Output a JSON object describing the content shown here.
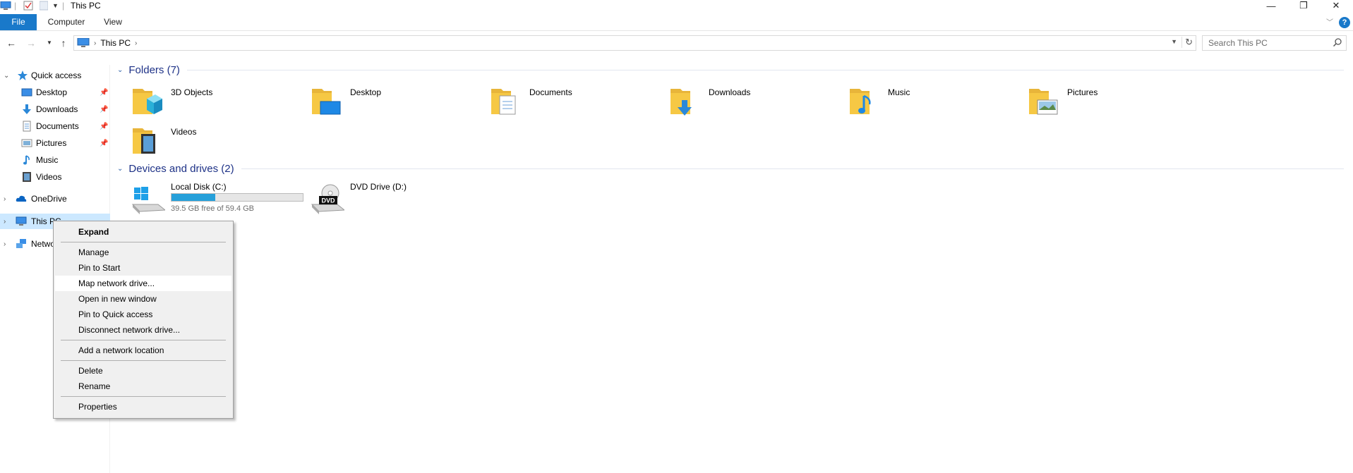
{
  "window": {
    "title": "This PC",
    "controls": {
      "minimize": "—",
      "restore": "❐",
      "close": "✕"
    }
  },
  "ribbon": {
    "tabs": [
      "File",
      "Computer",
      "View"
    ],
    "help": "?"
  },
  "address": {
    "path": "This PC",
    "search_placeholder": "Search This PC"
  },
  "nav": {
    "items": [
      {
        "label": "Quick access",
        "icon": "star-icon"
      },
      {
        "label": "Desktop",
        "icon": "desktop-icon"
      },
      {
        "label": "Downloads",
        "icon": "download-icon"
      },
      {
        "label": "Documents",
        "icon": "document-icon"
      },
      {
        "label": "Pictures",
        "icon": "pictures-icon"
      },
      {
        "label": "Music",
        "icon": "music-icon"
      },
      {
        "label": "Videos",
        "icon": "videos-icon"
      },
      {
        "label": "OneDrive",
        "icon": "cloud-icon"
      },
      {
        "label": "This PC",
        "icon": "computer-icon"
      },
      {
        "label": "Netwo",
        "icon": "network-icon"
      }
    ]
  },
  "content": {
    "folders_header": "Folders (7)",
    "folders": [
      "3D Objects",
      "Desktop",
      "Documents",
      "Downloads",
      "Music",
      "Pictures",
      "Videos"
    ],
    "drives_header": "Devices and drives (2)",
    "drives": [
      {
        "label": "Local Disk (C:)",
        "free": "39.5 GB free of 59.4 GB",
        "used_fraction": 0.335
      },
      {
        "label": "DVD Drive (D:)",
        "badge": "DVD"
      }
    ]
  },
  "context_menu": {
    "items": [
      "Expand",
      "Manage",
      "Pin to Start",
      "Map network drive...",
      "Open in new window",
      "Pin to Quick access",
      "Disconnect network drive...",
      "Add a network location",
      "Delete",
      "Rename",
      "Properties"
    ]
  },
  "colors": {
    "accent": "#1979ca",
    "selection": "#cce8ff",
    "folder": "#f6c844",
    "drive_fill": "#26a0da"
  }
}
